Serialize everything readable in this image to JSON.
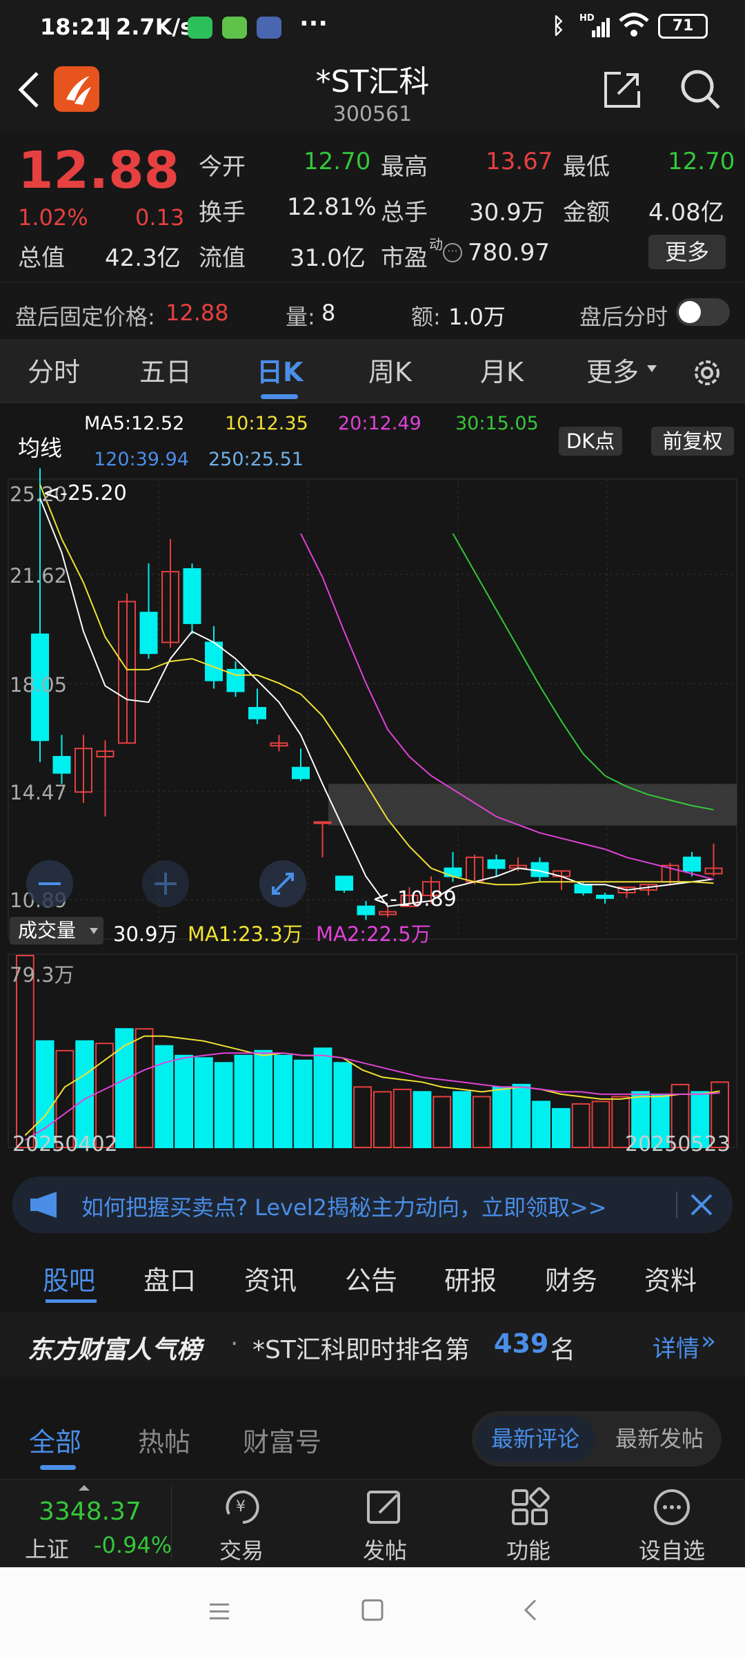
{
  "status": {
    "time": "18:21",
    "speed": "2.7K/s",
    "signal": "HD",
    "battery": "71"
  },
  "header": {
    "title": "*ST汇科",
    "code": "300561"
  },
  "quote": {
    "price": "12.88",
    "change_pct": "1.02%",
    "change": "0.13",
    "open_label": "今开",
    "open": "12.70",
    "high_label": "最高",
    "high": "13.67",
    "low_label": "最低",
    "low": "12.70",
    "turnover_label": "换手",
    "turnover": "12.81%",
    "volume_label": "总手",
    "volume": "30.9万",
    "amount_label": "金额",
    "amount": "4.08亿",
    "mktcap_label": "总值",
    "mktcap": "42.3亿",
    "float_label": "流值",
    "float": "31.0亿",
    "pe_label": "市盈",
    "pe_sup": "动",
    "pe": "780.97",
    "more_label": "更多",
    "after_price_label": "盘后固定价格:",
    "after_price": "12.88",
    "after_vol_label": "量:",
    "after_vol": "8",
    "after_amount_label": "额:",
    "after_amount": "1.0万",
    "after_time_label": "盘后分时"
  },
  "period_tabs": {
    "t0": "分时",
    "t1": "五日",
    "t2": "日K",
    "t3": "周K",
    "t4": "月K",
    "t5": "更多"
  },
  "ma": {
    "label": "均线",
    "ma5": "MA5:12.52",
    "ma10": "10:12.35",
    "ma20": "20:12.49",
    "ma30": "30:15.05",
    "ma120": "120:39.94",
    "ma250": "250:25.51",
    "dk_label": "DK点",
    "fq_label": "前复权"
  },
  "price_axis": {
    "p1": "25.20",
    "p2": "21.62",
    "p3": "18.05",
    "p4": "14.47",
    "p5": "10.89"
  },
  "markers": {
    "high": "<-25.20",
    "low": "<-10.89"
  },
  "vol_info": {
    "label": "成交量",
    "vol": "30.9万",
    "ma1": "MA1:23.3万",
    "ma2": "MA2:22.5万",
    "max": "79.3万"
  },
  "dates": {
    "start": "20250402",
    "end": "20250523"
  },
  "banner": {
    "text": "如何把握买卖点? Level2揭秘主力动向，立即领取>>"
  },
  "section_tabs": {
    "s0": "股吧",
    "s1": "盘口",
    "s2": "资讯",
    "s3": "公告",
    "s4": "研报",
    "s5": "财务",
    "s6": "资料"
  },
  "rank": {
    "brand": "东方财富人气榜",
    "prefix": "*ST汇科即时排名第",
    "number": "439",
    "suffix": "名",
    "detail": "详情"
  },
  "post_tabs": {
    "all": "全部",
    "hot": "热帖",
    "wealth": "财富号",
    "latest_comment": "最新评论",
    "latest_post": "最新发帖"
  },
  "footer": {
    "index_value": "3348.37",
    "index_name": "上证",
    "index_change": "-0.94%",
    "trade": "交易",
    "post": "发帖",
    "func": "功能",
    "watch": "设自选"
  },
  "colors": {
    "up": "#e64040",
    "down": "#00f0f0",
    "accent": "#4a8ee8",
    "ma5": "#ffffff",
    "ma10": "#f2e232",
    "ma20": "#e043d8",
    "ma30": "#35c73a"
  },
  "chart_data": {
    "type": "candlestick",
    "ylim": [
      10.89,
      25.2
    ],
    "candles": [
      {
        "o": 21.5,
        "c": 17.6,
        "h": 27.6,
        "l": 16.8
      },
      {
        "o": 17.0,
        "c": 16.4,
        "h": 17.8,
        "l": 16.0
      },
      {
        "o": 15.7,
        "c": 17.3,
        "h": 17.8,
        "l": 15.3
      },
      {
        "o": 17.0,
        "c": 17.2,
        "h": 17.6,
        "l": 14.8
      },
      {
        "o": 17.5,
        "c": 22.7,
        "h": 23.0,
        "l": 17.5
      },
      {
        "o": 22.3,
        "c": 20.8,
        "h": 24.1,
        "l": 20.6
      },
      {
        "o": 21.2,
        "c": 23.8,
        "h": 25.0,
        "l": 21.0
      },
      {
        "o": 23.9,
        "c": 21.9,
        "h": 24.1,
        "l": 21.5
      },
      {
        "o": 21.2,
        "c": 19.8,
        "h": 21.8,
        "l": 19.5
      },
      {
        "o": 20.2,
        "c": 19.4,
        "h": 20.5,
        "l": 19.2
      },
      {
        "o": 18.8,
        "c": 18.4,
        "h": 19.5,
        "l": 18.2
      },
      {
        "o": 17.4,
        "c": 17.5,
        "h": 17.8,
        "l": 17.2
      },
      {
        "o": 16.6,
        "c": 16.2,
        "h": 17.3,
        "l": 16.1
      },
      {
        "o": 14.6,
        "c": 14.6,
        "h": 14.6,
        "l": 13.3
      },
      {
        "o": 12.6,
        "c": 12.1,
        "h": 12.6,
        "l": 12.0
      },
      {
        "o": 11.5,
        "c": 11.2,
        "h": 11.7,
        "l": 11.0
      },
      {
        "o": 11.2,
        "c": 11.3,
        "h": 11.5,
        "l": 11.1
      },
      {
        "o": 11.5,
        "c": 11.9,
        "h": 12.2,
        "l": 11.5
      },
      {
        "o": 11.9,
        "c": 12.4,
        "h": 12.6,
        "l": 11.6
      },
      {
        "o": 12.9,
        "c": 12.6,
        "h": 13.5,
        "l": 12.4
      },
      {
        "o": 12.4,
        "c": 13.3,
        "h": 13.4,
        "l": 12.3
      },
      {
        "o": 13.2,
        "c": 12.9,
        "h": 13.4,
        "l": 12.6
      },
      {
        "o": 12.9,
        "c": 13.0,
        "h": 13.3,
        "l": 12.8
      },
      {
        "o": 13.1,
        "c": 12.6,
        "h": 13.3,
        "l": 12.4
      },
      {
        "o": 12.6,
        "c": 12.8,
        "h": 12.8,
        "l": 12.1
      },
      {
        "o": 12.3,
        "c": 12.0,
        "h": 12.4,
        "l": 11.9
      },
      {
        "o": 11.9,
        "c": 11.8,
        "h": 12.0,
        "l": 11.6
      },
      {
        "o": 12.0,
        "c": 12.2,
        "h": 12.2,
        "l": 11.8
      },
      {
        "o": 12.1,
        "c": 12.3,
        "h": 12.3,
        "l": 11.9
      },
      {
        "o": 12.4,
        "c": 13.0,
        "h": 13.1,
        "l": 12.3
      },
      {
        "o": 13.3,
        "c": 12.8,
        "h": 13.5,
        "l": 12.6
      },
      {
        "o": 12.7,
        "c": 12.9,
        "h": 13.8,
        "l": 12.6
      }
    ],
    "ma5": [
      26.5,
      24.5,
      21.6,
      19.6,
      19.1,
      19.0,
      20.6,
      21.6,
      21.2,
      20.6,
      19.8,
      19.0,
      17.8,
      16.0,
      14.3,
      12.6,
      11.5,
      11.6,
      11.7,
      12.2,
      12.4,
      12.6,
      12.9,
      12.8,
      12.6,
      12.3,
      12.3,
      12.1,
      12.2,
      12.3,
      12.4,
      12.5
    ],
    "ma10": [
      27.0,
      25.0,
      23.4,
      21.4,
      20.2,
      20.2,
      20.5,
      20.6,
      20.3,
      20.0,
      20.0,
      19.7,
      19.3,
      18.5,
      17.3,
      16.0,
      14.7,
      13.7,
      12.9,
      12.6,
      12.4,
      12.3,
      12.3,
      12.4,
      12.4,
      12.4,
      12.4,
      12.4,
      12.4,
      12.4,
      12.4,
      12.35
    ],
    "ma20": [
      null,
      null,
      null,
      null,
      null,
      null,
      null,
      null,
      null,
      null,
      null,
      null,
      25.2,
      23.6,
      21.6,
      19.7,
      18.0,
      17.0,
      16.3,
      15.8,
      15.3,
      14.8,
      14.5,
      14.2,
      14.0,
      13.8,
      13.6,
      13.3,
      13.1,
      12.9,
      12.7,
      12.49
    ],
    "ma30": [
      null,
      null,
      null,
      null,
      null,
      null,
      null,
      null,
      null,
      null,
      null,
      null,
      null,
      null,
      null,
      null,
      null,
      null,
      null,
      25.2,
      23.8,
      22.4,
      21.0,
      19.6,
      18.3,
      17.1,
      16.3,
      15.9,
      15.6,
      15.4,
      15.2,
      15.05
    ],
    "band": [
      14.47,
      16.0
    ],
    "volumes": [
      79.3,
      44,
      40,
      44,
      43,
      49,
      49,
      42,
      38,
      37,
      35,
      38,
      40,
      38,
      36,
      41,
      35,
      25,
      23,
      24,
      23,
      21,
      23,
      21,
      25,
      26,
      19,
      16,
      18,
      19,
      21,
      23,
      22,
      26,
      23,
      27
    ],
    "vol_up": [
      true,
      false,
      true,
      false,
      true,
      false,
      true,
      false,
      false,
      false,
      false,
      false,
      false,
      false,
      false,
      false,
      false,
      true,
      true,
      true,
      false,
      true,
      false,
      true,
      false,
      false,
      false,
      false,
      true,
      true,
      true,
      false,
      false,
      true,
      false,
      true
    ],
    "vol_ma1": [
      5,
      13,
      25,
      30,
      36,
      42,
      46,
      46,
      45,
      44,
      42,
      40,
      38,
      39,
      38,
      38,
      37,
      32,
      29,
      28,
      27,
      25,
      24,
      23,
      24,
      25,
      24,
      22,
      21,
      20,
      20,
      21,
      21,
      22,
      22,
      23.3
    ],
    "vol_ma2": [
      3,
      8,
      14,
      20,
      24,
      28,
      32,
      35,
      37,
      38,
      39,
      39,
      39,
      39,
      38,
      38,
      37,
      35,
      33,
      31,
      29,
      28,
      27,
      26,
      25,
      25,
      24,
      23,
      23,
      22,
      22,
      22,
      22,
      22,
      22,
      22.5
    ]
  }
}
